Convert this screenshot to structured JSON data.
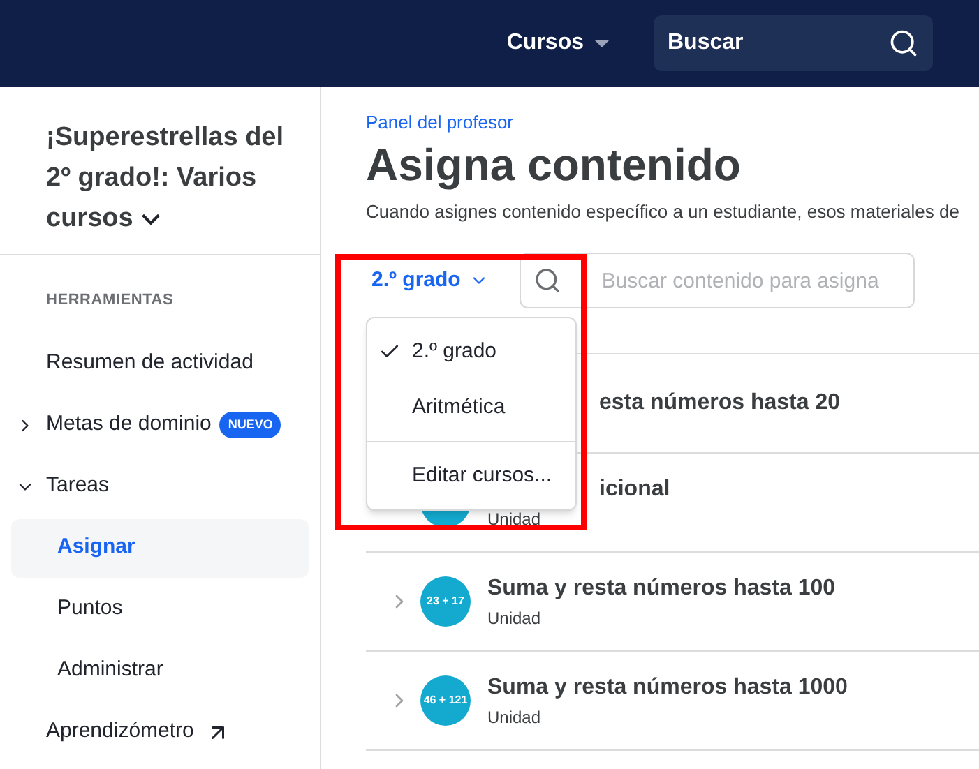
{
  "header": {
    "courses_menu": "Cursos",
    "search": {
      "value": "Buscar"
    }
  },
  "sidebar": {
    "title": "¡Superestrellas del 2º grado!: Varios cursos",
    "section": "HERRAMIENTAS",
    "items": [
      {
        "label": "Resumen de actividad",
        "kind": "plain",
        "selected": false
      },
      {
        "label": "Metas de dominio",
        "kind": "group",
        "expanded": false,
        "badge": "NUEVO",
        "selected": false
      },
      {
        "label": "Tareas",
        "kind": "group",
        "expanded": true,
        "selected": false,
        "children": [
          {
            "label": "Asignar",
            "selected": true
          },
          {
            "label": "Puntos",
            "selected": false
          },
          {
            "label": "Administrar",
            "selected": false
          }
        ]
      },
      {
        "label": "Aprendizómetro",
        "kind": "external",
        "selected": false
      }
    ]
  },
  "main": {
    "breadcrumb": "Panel del profesor",
    "title": "Asigna contenido",
    "description": "Cuando asignes contenido específico a un estudiante, esos materiales de",
    "course_select": "2.º grado",
    "search": {
      "placeholder": "Buscar contenido para asigna"
    },
    "dropdown": {
      "items": [
        {
          "label": "2.º grado",
          "selected": true
        },
        {
          "label": "Aritmética",
          "selected": false
        }
      ],
      "footer": "Editar cursos..."
    },
    "rows": [
      {
        "kind": "covered",
        "title": "esta números hasta 20"
      },
      {
        "kind": "partial",
        "title": "icional",
        "subtitle": "Unidad"
      },
      {
        "kind": "full",
        "title": "Suma y resta números hasta 100",
        "subtitle": "Unidad",
        "icon_label": "23 + 17"
      },
      {
        "kind": "full",
        "title": "Suma y resta números hasta 1000",
        "subtitle": "Unidad",
        "icon_label": "46 + 121"
      }
    ]
  }
}
